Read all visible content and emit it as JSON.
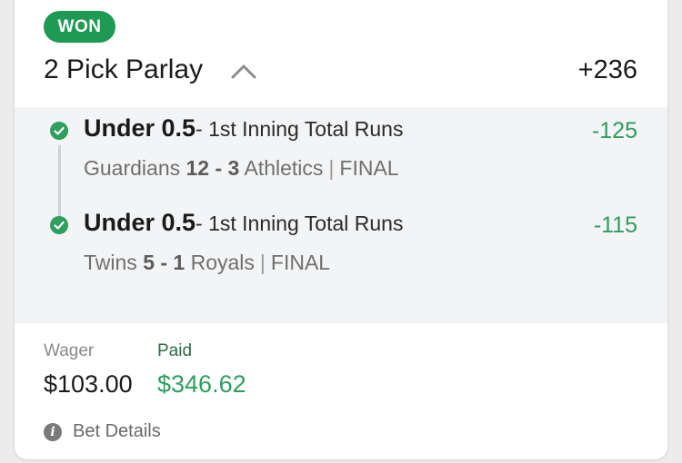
{
  "bet": {
    "status": "WON",
    "title": "2 Pick Parlay",
    "total_odds": "+236",
    "legs": [
      {
        "pick": "Under 0.5",
        "market": "- 1st Inning Total Runs",
        "odds": "-125",
        "team_home": "Guardians",
        "score": "12 - 3",
        "team_away": "Athletics",
        "separator": "|",
        "state": "FINAL"
      },
      {
        "pick": "Under 0.5",
        "market": "- 1st Inning Total Runs",
        "odds": "-115",
        "team_home": "Twins",
        "score": "5 - 1",
        "team_away": "Royals",
        "separator": "|",
        "state": "FINAL"
      }
    ],
    "wager_label": "Wager",
    "wager_value": "$103.00",
    "paid_label": "Paid",
    "paid_value": "$346.62",
    "details_label": "Bet Details"
  },
  "icons": {
    "collapse": "chevron-up-icon",
    "leg_status": "check-circle-icon",
    "details": "info-icon"
  },
  "colors": {
    "won_badge": "#1f9a55",
    "positive": "#2f9e5f",
    "leg_background": "#f3f4f5"
  }
}
